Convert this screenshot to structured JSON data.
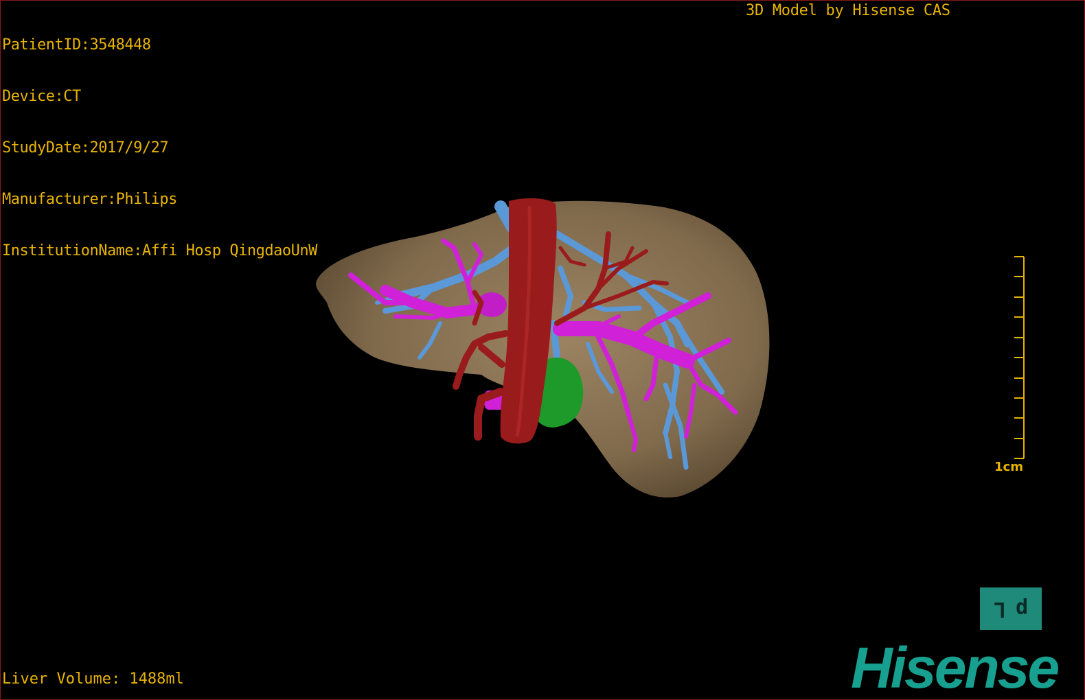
{
  "overlay": {
    "patient_id": "PatientID:3548448",
    "device": "Device:CT",
    "study_date": "StudyDate:2017/9/27",
    "manufacturer": "Manufacturer:Philips",
    "institution": "InstitutionName:Affi Hosp QingdaoUnW",
    "credit": "3D Model by Hisense CAS",
    "liver_volume": "Liver Volume: 1488ml"
  },
  "scale_bar": {
    "label": "1cm"
  },
  "orientation_cube": {
    "face_left": "L",
    "face_right": "p"
  },
  "brand": {
    "logo_text": "Hisense"
  },
  "colors": {
    "overlay_text": "#e8b400",
    "liver": "#8c7656",
    "aorta": "#9a1b1b",
    "portal_vein": "#d020d8",
    "hepatic_vein": "#5b98d8",
    "gallbladder": "#1e9a2a",
    "brand": "#17a08f"
  }
}
